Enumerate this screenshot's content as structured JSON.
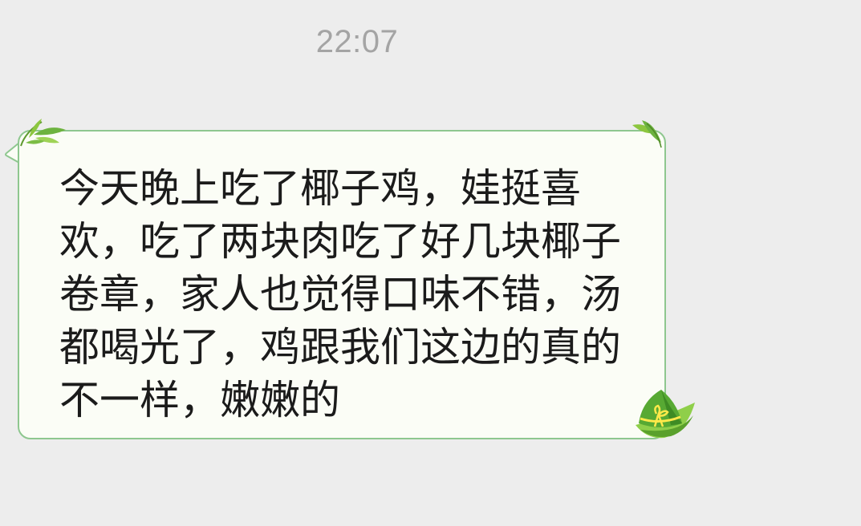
{
  "chat": {
    "timestamp": "22:07",
    "message": {
      "text": "今天晚上吃了椰子鸡，娃挺喜欢，吃了两块肉吃了好几块椰子卷章，家人也觉得口味不错，汤都喝光了，鸡跟我们这边的真的不一样，嫩嫩的"
    },
    "bubble_style": {
      "background": "#fbfdf6",
      "border": "#8ec78f",
      "decoration_icons": [
        "bamboo-leaf-icon",
        "bamboo-leaf-icon",
        "zongzi-icon"
      ]
    }
  }
}
